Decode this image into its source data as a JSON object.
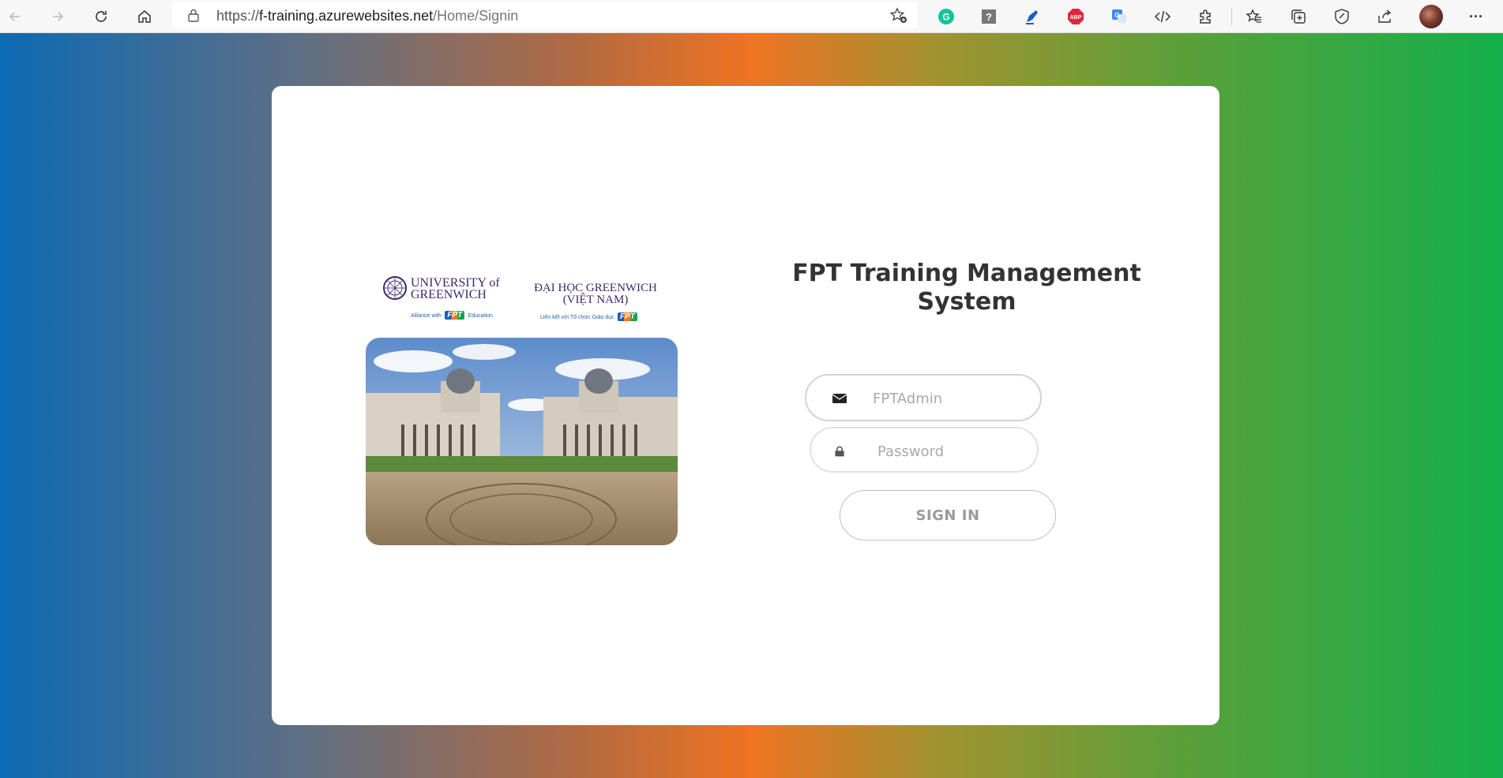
{
  "browser": {
    "url_prefix": "https://",
    "url_domain": "f-training.azurewebsites.net",
    "url_path": "/Home/Signin",
    "extensions": [
      "grammarly-icon",
      "help-extension-icon",
      "pen-extension-icon",
      "adblock-plus-icon",
      "google-translate-icon",
      "dev-tools-icon",
      "extensions-puzzle-icon",
      "favorites-icon",
      "collections-icon",
      "browser-essentials-icon",
      "share-icon"
    ],
    "abp_text": "ABP",
    "menu_label": "···"
  },
  "logos": {
    "greenwich_line1": "UNIVERSITY of",
    "greenwich_line2": "GREENWICH",
    "greenwich_alliance": "Alliance with",
    "greenwich_education": "Education",
    "fpt": "FPT",
    "vn_line1": "ĐẠI HỌC GREENWICH",
    "vn_line2": "(VIỆT NAM)",
    "vn_tagline": "Liên kết với Tổ chức Giáo dục"
  },
  "login": {
    "title": "FPT Training Management System",
    "email_placeholder": "FPTAdmin",
    "password_placeholder": "Password",
    "signin_label": "SIGN IN"
  },
  "colors": {
    "gradient_left": "#0d6ab3",
    "gradient_mid": "#ef7322",
    "gradient_right": "#13b04b"
  }
}
